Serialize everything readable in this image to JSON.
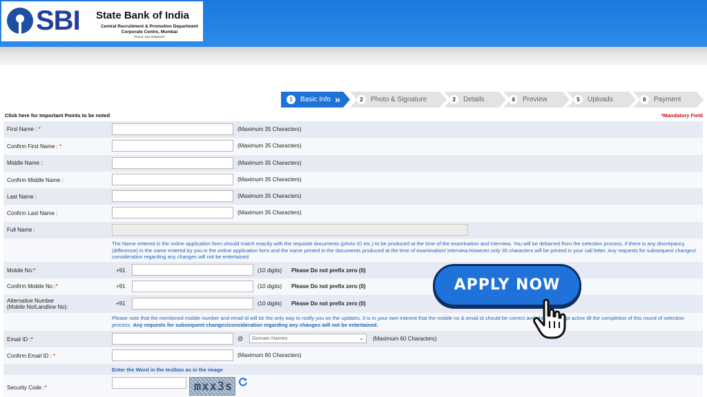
{
  "header": {
    "logo_text": "SBI",
    "bank_name": "State Bank of India",
    "department": "Central Recruitment & Promotion Department",
    "office": "Corporate Centre, Mumbai",
    "phone": "Phone: 022-22820427",
    "brand_color": "#1f73d8"
  },
  "steps": [
    {
      "num": "1",
      "label": "Basic Info",
      "active": true
    },
    {
      "num": "2",
      "label": "Photo & Signature",
      "active": false
    },
    {
      "num": "3",
      "label": "Details",
      "active": false
    },
    {
      "num": "4",
      "label": "Preview",
      "active": false
    },
    {
      "num": "5",
      "label": "Uploads",
      "active": false
    },
    {
      "num": "6",
      "label": "Payment",
      "active": false
    }
  ],
  "links": {
    "important_points": "Click here for Important Points to be noted",
    "mandatory_field": "*Mandatory Field"
  },
  "form": {
    "first_name": {
      "label": "First Name :",
      "required": "*",
      "hint": "(Maximum 35 Characters)",
      "value": ""
    },
    "confirm_first_name": {
      "label": "Confirm First Name :",
      "required": "*",
      "hint": "(Maximum 35 Characters)",
      "value": ""
    },
    "middle_name": {
      "label": "Middle Name :",
      "hint": "(Maximum 35 Characters)",
      "value": ""
    },
    "confirm_middle_name": {
      "label": "Confirm Middle Name :",
      "hint": "(Maximum 35 Characters)",
      "value": ""
    },
    "last_name": {
      "label": "Last Name :",
      "hint": "(Maximum 35 Characters)",
      "value": ""
    },
    "confirm_last_name": {
      "label": "Confirm Last Name :",
      "hint": "(Maximum 35 Characters)",
      "value": ""
    },
    "full_name": {
      "label": "Full Name :",
      "value": ""
    },
    "name_info": "The Name entered in the online application form should match exactly with the requisite documents (photo ID etc.) to be produced at the time of the examination and interview. You will be debarred from the selection process, if there is any discrepancy (difference) in the name entered by you in the online application form and the name printed in the documents produced at the time of examination/ interview.However only 35 characters will be printed in your call letter. Any requests for subsequent changes/ consideration regarding any changes will not be entertained",
    "mobile": {
      "label": "Mobile No:",
      "required": "*",
      "prefix": "+91",
      "hint": "(10 digits)",
      "note": "Please Do not prefix zero (0)",
      "value": ""
    },
    "confirm_mobile": {
      "label": "Confirm Mobile No :",
      "required": "*",
      "prefix": "+91",
      "hint": "(10 digits)",
      "note": "Please Do not prefix zero (0)",
      "value": ""
    },
    "alt_number": {
      "label_line1": "Alternative Number",
      "label_line2": "(Mobile No/Landline No):",
      "prefix": "+91",
      "hint": "(10 digits)",
      "note": "Please Do not prefix zero (0)",
      "value": ""
    },
    "contact_info_part1": "Please note that the mentioned mobile number and email id will be the only way to notify you on the updates. It is in your own interest that the mobile no & email id should be correct and should be kept active till the completion of this round of selection process.",
    "contact_info_part2": "Any requests for subsequent changes/consideration regarding any changes will not be entertained.",
    "email": {
      "label": "Email ID :",
      "required": "*",
      "at": "@",
      "domain_placeholder": "Domain Names",
      "hint": "(Maximum 60 Characters)",
      "value": ""
    },
    "confirm_email": {
      "label": "Confirm Email ID :",
      "required": "*",
      "hint": "(Maximum 60 Characters)",
      "value": ""
    },
    "word_instruction": "Enter the Word in the textbox as in the image",
    "security_code": {
      "label": "Security Code :",
      "required": "*",
      "captcha_text": "mxx3s",
      "value": ""
    }
  },
  "overlay": {
    "apply_now": "APPLY NOW"
  }
}
